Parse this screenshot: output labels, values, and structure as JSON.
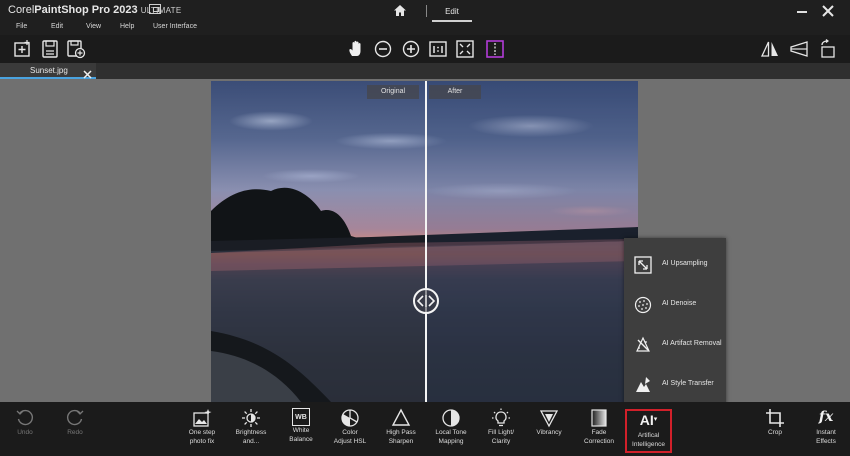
{
  "titlebar": {
    "brand_prefix": "Corel",
    "brand_name": "PaintShop",
    "product": "Pro 2023",
    "edition": "ULTIMATE",
    "workspace_tab": "Edit",
    "home_icon": "home-icon",
    "minimize_icon": "minimize-icon",
    "close_icon": "close-icon"
  },
  "menu": [
    "File",
    "Edit",
    "View",
    "Help",
    "User Interface"
  ],
  "toolbar": {
    "left_icons": [
      "new-image-icon",
      "save-icon",
      "save-as-icon"
    ],
    "center_icons": [
      "pan-hand-icon",
      "zoom-out-icon",
      "zoom-in-icon",
      "actual-size-icon",
      "fit-window-icon",
      "split-compare-icon"
    ],
    "right_icons": [
      "flip-horizontal-icon",
      "perspective-icon",
      "rotate-icon"
    ],
    "active_color": "#b23cd8"
  },
  "document": {
    "tab_name": "Sunset.jpg",
    "accent": "#4aa3e0"
  },
  "compare": {
    "original_label": "Original",
    "after_label": "After"
  },
  "ai_menu": {
    "items": [
      {
        "label": "AI Upsampling",
        "icon": "upsampling-icon"
      },
      {
        "label": "AI Denoise",
        "icon": "denoise-icon"
      },
      {
        "label": "AI Artifact Removal",
        "icon": "artifact-removal-icon"
      },
      {
        "label": "AI Style Transfer",
        "icon": "style-transfer-icon"
      }
    ]
  },
  "bottom": {
    "undo": "Undo",
    "redo": "Redo",
    "one_step_1": "One step",
    "one_step_2": "photo fix",
    "brightness_1": "Brightness",
    "brightness_2": "and...",
    "white_1": "White",
    "white_2": "Balance",
    "wb_glyph": "WB",
    "color_1": "Color",
    "color_2": "Adjust HSL",
    "highpass_1": "High Pass",
    "highpass_2": "Sharpen",
    "localtone_1": "Local Tone",
    "localtone_2": "Mapping",
    "filllight_1": "Fill Light/",
    "filllight_2": "Clarity",
    "vibrancy": "Vibrancy",
    "fade_1": "Fade",
    "fade_2": "Correction",
    "ai_glyph": "AI",
    "ai_1": "Artifical",
    "ai_2": "Intelligence",
    "crop": "Crop",
    "instant_1": "Instant",
    "instant_2": "Effects",
    "fx_glyph": "fx",
    "highlight_color": "#d2202a"
  }
}
